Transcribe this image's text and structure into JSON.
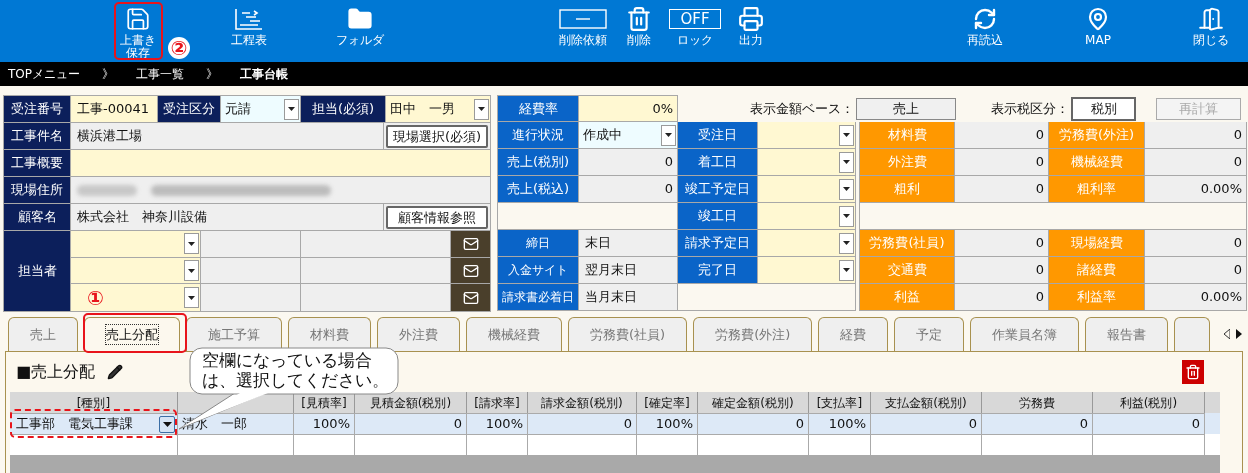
{
  "toolbar": {
    "left": [
      {
        "label": [
          "上書き",
          "保存"
        ]
      },
      {
        "label": "工程表"
      },
      {
        "label": "フォルダ"
      }
    ],
    "center": [
      {
        "label": "削除依頼"
      },
      {
        "label": "削除"
      },
      {
        "label": "ロック",
        "badge": "OFF"
      },
      {
        "label": "出力"
      }
    ],
    "right": [
      {
        "label": "再読込"
      },
      {
        "label": "MAP"
      },
      {
        "label": "閉じる"
      }
    ]
  },
  "breadcrumb": {
    "items": [
      {
        "label": "TOPメニュー",
        "current": false
      },
      {
        "label": "工事一覧",
        "current": false
      },
      {
        "label": "工事台帳",
        "current": true
      }
    ],
    "separators": [
      "》",
      "》"
    ]
  },
  "order_form": {
    "number_label": "受注番号",
    "number": "工事-00041",
    "type_label": "受注区分",
    "type": "元請",
    "manager_label": "担当(必須)",
    "manager": "田中　一男",
    "project_label": "工事件名",
    "project": "横浜港工場",
    "project_button": "現場選択(必須)",
    "overview_label": "工事概要",
    "address_label": "現場住所",
    "customer_label": "顧客名",
    "customer": "株式会社　神奈川設備",
    "customer_button": "顧客情報参照",
    "staff_label": "担当者"
  },
  "expense_rate": {
    "label": "経費率",
    "value": "0%"
  },
  "display_base": {
    "label": "表示金額ベース：",
    "value": "売上"
  },
  "tax_display": {
    "label": "表示税区分：",
    "value": "税別"
  },
  "recalc": {
    "label": "再計算",
    "disabled": true
  },
  "status": [
    {
      "label": "進行状況",
      "value": "作成中",
      "kind": "select"
    },
    {
      "label": "売上(税別)",
      "value": "0",
      "kind": "amount"
    },
    {
      "label": "売上(税込)",
      "value": "0",
      "kind": "amount"
    }
  ],
  "billing": [
    {
      "label": "締日",
      "value": "末日"
    },
    {
      "label": "入金サイト",
      "value": "翌月末日"
    },
    {
      "label": "請求書必着日",
      "value": "当月末日"
    }
  ],
  "dates": [
    {
      "label": "受注日"
    },
    {
      "label": "着工日"
    },
    {
      "label": "竣工予定日"
    },
    {
      "label": "竣工日"
    },
    {
      "label": "請求予定日"
    },
    {
      "label": "完了日"
    }
  ],
  "costs_top": [
    [
      {
        "label": "材料費",
        "value": "0"
      },
      {
        "label": "労務費(外注)",
        "value": "0"
      }
    ],
    [
      {
        "label": "外注費",
        "value": "0"
      },
      {
        "label": "機械経費",
        "value": "0"
      }
    ],
    [
      {
        "label": "粗利",
        "value": "0"
      },
      {
        "label": "粗利率",
        "value": "0.00%"
      }
    ]
  ],
  "costs_bottom": [
    [
      {
        "label": "労務費(社員)",
        "value": "0"
      },
      {
        "label": "現場経費",
        "value": "0"
      }
    ],
    [
      {
        "label": "交通費",
        "value": "0"
      },
      {
        "label": "諸経費",
        "value": "0"
      }
    ],
    [
      {
        "label": "利益",
        "value": "0"
      },
      {
        "label": "利益率",
        "value": "0.00%"
      }
    ]
  ],
  "tabs": [
    {
      "label": "売上",
      "selected": false
    },
    {
      "label": "売上分配",
      "selected": true
    },
    {
      "label": "施工予算",
      "selected": false
    },
    {
      "label": "材料費",
      "selected": false
    },
    {
      "label": "外注費",
      "selected": false
    },
    {
      "label": "機械経費",
      "selected": false
    },
    {
      "label": "労務費(社員)",
      "selected": false
    },
    {
      "label": "労務費(外注)",
      "selected": false
    },
    {
      "label": "経費",
      "selected": false
    },
    {
      "label": "予定",
      "selected": false
    },
    {
      "label": "作業員名簿",
      "selected": false
    },
    {
      "label": "報告書",
      "selected": false
    },
    {
      "selected": false
    }
  ],
  "section": {
    "title": "■売上分配"
  },
  "table": {
    "columns": [
      {
        "label": "[種別]",
        "kind": "select"
      },
      {
        "kind": "text"
      },
      {
        "label": "[見積率]",
        "kind": "number"
      },
      {
        "label": "見積金額(税別)",
        "kind": "number"
      },
      {
        "label": "[請求率]",
        "kind": "number"
      },
      {
        "label": "請求金額(税別)",
        "kind": "number"
      },
      {
        "label": "[確定率]",
        "kind": "number"
      },
      {
        "label": "確定金額(税別)",
        "kind": "number"
      },
      {
        "label": "[支払率]",
        "kind": "number"
      },
      {
        "label": "支払金額(税別)",
        "kind": "number"
      },
      {
        "label": "労務費",
        "kind": "number"
      },
      {
        "label": "利益(税別)",
        "kind": "number"
      }
    ],
    "rows": [
      [
        "工事部　電気工事課",
        "清水　一郎",
        "100%",
        "0",
        "100%",
        "0",
        "100%",
        "0",
        "100%",
        "0",
        "0",
        "0"
      ]
    ]
  },
  "annotations": {
    "marks": [
      "②",
      "①"
    ],
    "callout": "空欄になっている場合は、選択してください。"
  }
}
